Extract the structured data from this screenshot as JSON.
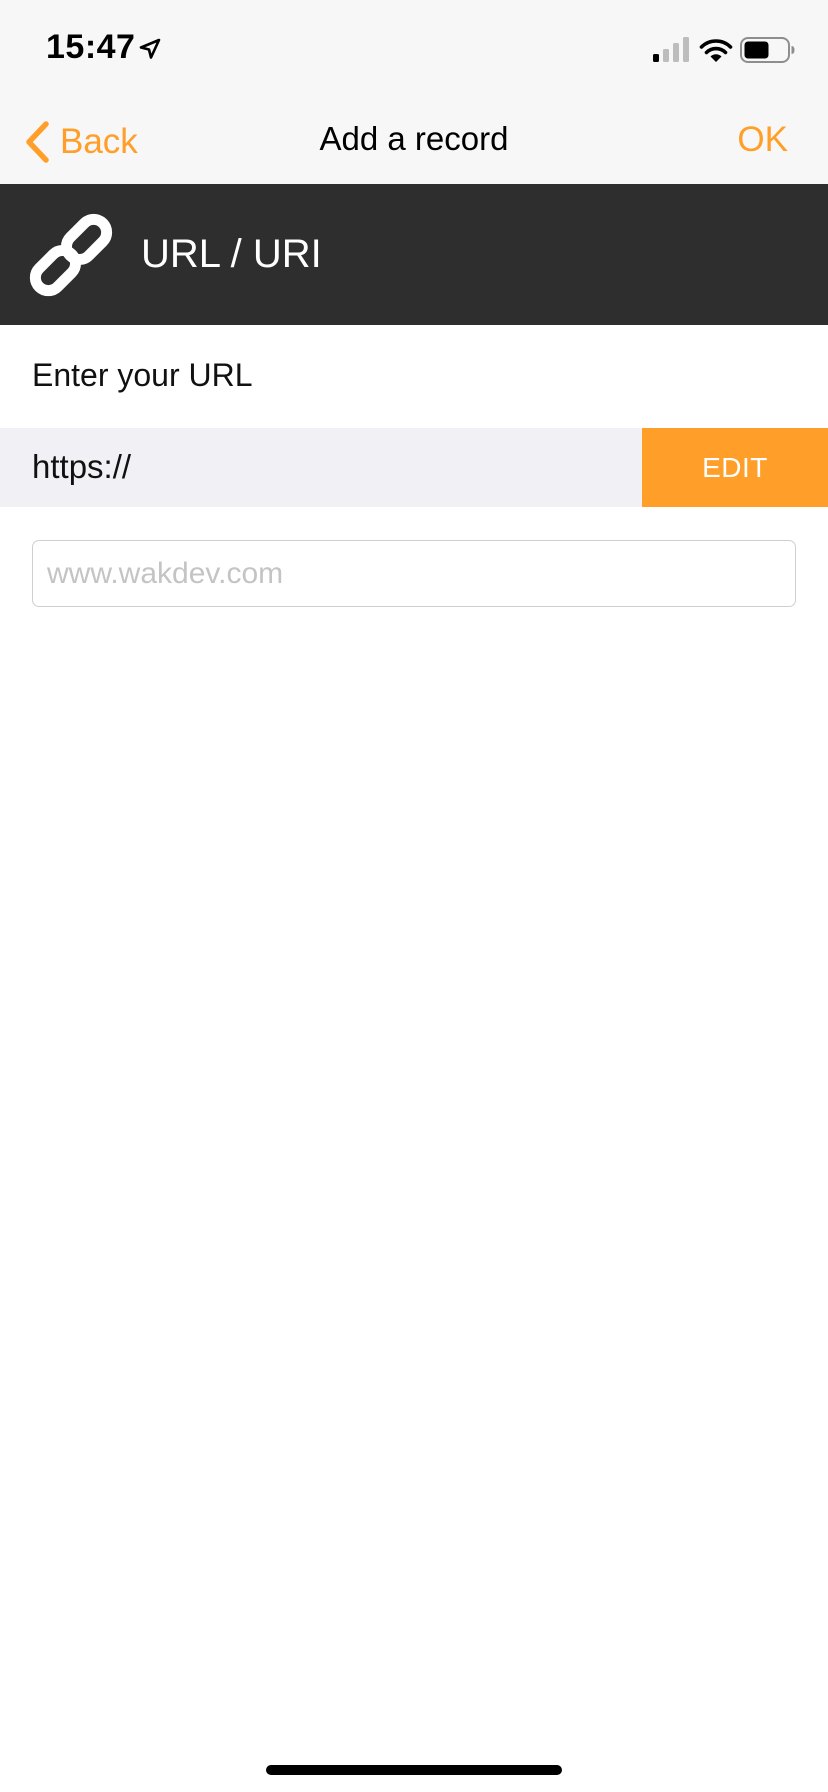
{
  "status_bar": {
    "time": "15:47",
    "icons": [
      "location-arrow-icon",
      "cellular-signal-icon",
      "wifi-icon",
      "battery-icon"
    ]
  },
  "nav": {
    "back_label": "Back",
    "title": "Add a record",
    "ok_label": "OK"
  },
  "record_type": {
    "icon": "link-icon",
    "title": "URL / URI"
  },
  "form": {
    "prompt": "Enter your URL",
    "scheme": "https://",
    "edit_label": "EDIT",
    "url_value": "",
    "url_placeholder": "www.wakdev.com"
  },
  "colors": {
    "accent": "#ff9f29",
    "header_bg": "#2e2e2e",
    "bar_bg": "#f7f7f7",
    "scheme_row_bg": "#f1f1f5"
  }
}
